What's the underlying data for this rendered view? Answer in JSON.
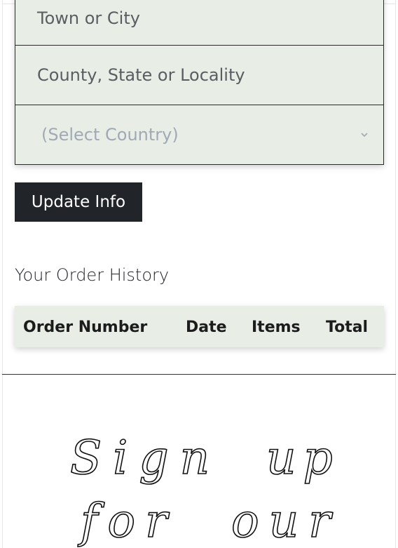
{
  "address_form": {
    "town_placeholder": "Town or City",
    "county_placeholder": "County, State or Locality",
    "country_select": "(Select Country)",
    "update_button": "Update Info"
  },
  "order_history": {
    "title": "Your Order History",
    "columns": [
      "Order Number",
      "Date",
      "Items",
      "Total"
    ]
  },
  "signup_banner": {
    "line1_word1": "Sign",
    "line1_word2": "up",
    "line2_word1": "for",
    "line2_word2": "our"
  },
  "colors": {
    "field_bg": "#e8ede6",
    "button_bg": "#212529",
    "placeholder_text": "#5a5e63",
    "select_text": "#a0a9b5"
  }
}
